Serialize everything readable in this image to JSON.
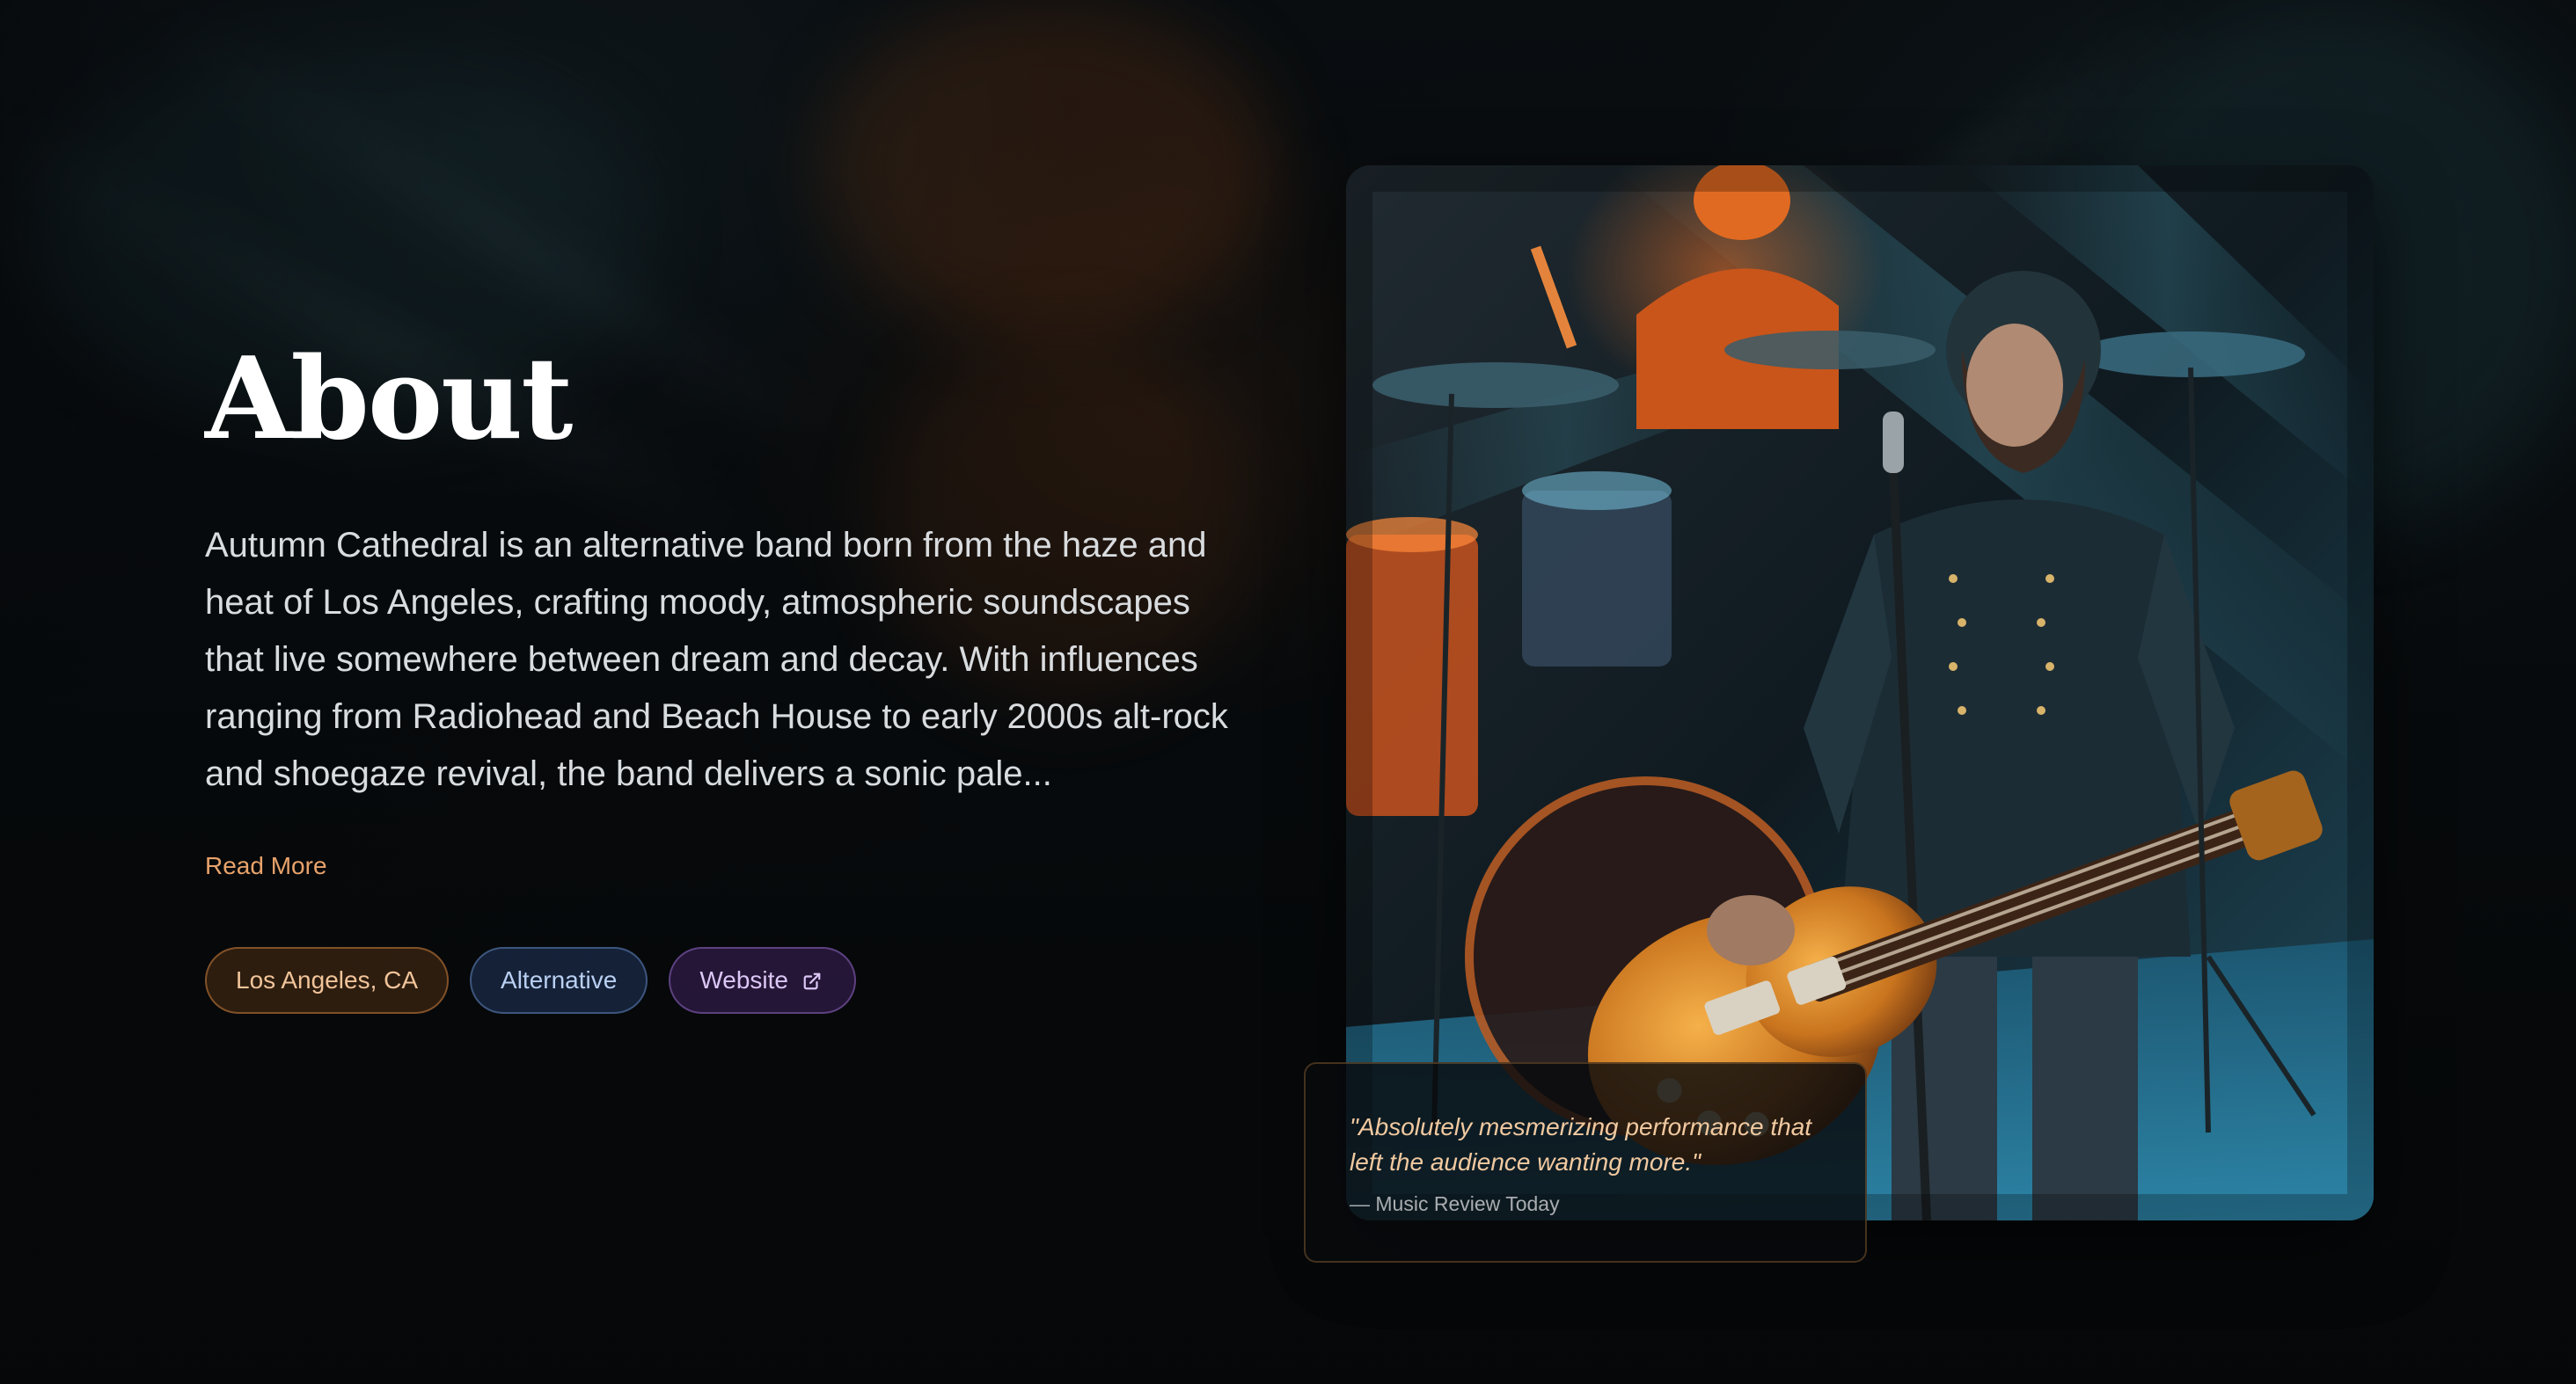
{
  "about": {
    "title": "About",
    "bio": "Autumn Cathedral is an alternative band born from the haze and heat of Los Angeles, crafting moody, atmospheric soundscapes that live somewhere between dream and decay. With influences ranging from Radiohead and Beach House to early 2000s alt-rock and shoegaze revival, the band delivers a sonic pale...",
    "read_more_label": "Read More"
  },
  "tags": {
    "location": "Los Angeles, CA",
    "genre": "Alternative",
    "website": "Website"
  },
  "quote": {
    "text": "\"Absolutely mesmerizing performance that left the audience wanting more.\"",
    "source": "— Music Review Today"
  },
  "colors": {
    "accent_orange": "#e8a26a",
    "quote_text": "#f1c9a0",
    "stage_teal": "#2aa3c8",
    "stage_orange": "#e0621c"
  },
  "icons": {
    "website_link": "external-link-icon"
  }
}
